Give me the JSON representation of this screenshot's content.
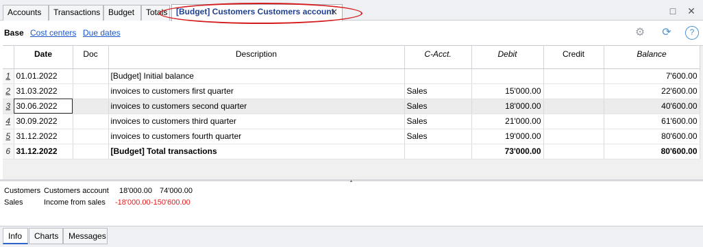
{
  "tabs": [
    {
      "label": "Accounts"
    },
    {
      "label": "Transactions"
    },
    {
      "label": "Budget"
    },
    {
      "label": "Totals"
    },
    {
      "label": "[Budget] Customers Customers account"
    }
  ],
  "window_buttons": {
    "restore": "□",
    "close": "✕"
  },
  "subtabs": {
    "base": "Base",
    "cost_centers": "Cost centers",
    "due_dates": "Due dates"
  },
  "toolbar": {
    "help": "?"
  },
  "columns": [
    "Date",
    "Doc",
    "Description",
    "C-Acct.",
    "Debit",
    "Credit",
    "Balance"
  ],
  "rows": [
    {
      "num": "1",
      "date": "01.01.2022",
      "doc": "",
      "desc": "[Budget] Initial balance",
      "cacct": "",
      "debit": "",
      "credit": "",
      "balance": "7'600.00"
    },
    {
      "num": "2",
      "date": "31.03.2022",
      "doc": "",
      "desc": "invoices to customers first quarter",
      "cacct": "Sales",
      "debit": "15'000.00",
      "credit": "",
      "balance": "22'600.00"
    },
    {
      "num": "3",
      "date": "30.06.2022",
      "doc": "",
      "desc": "invoices to customers second quarter",
      "cacct": "Sales",
      "debit": "18'000.00",
      "credit": "",
      "balance": "40'600.00"
    },
    {
      "num": "4",
      "date": "30.09.2022",
      "doc": "",
      "desc": "invoices to customers third quarter",
      "cacct": "Sales",
      "debit": "21'000.00",
      "credit": "",
      "balance": "61'600.00"
    },
    {
      "num": "5",
      "date": "31.12.2022",
      "doc": "",
      "desc": "invoices to customers fourth quarter",
      "cacct": "Sales",
      "debit": "19'000.00",
      "credit": "",
      "balance": "80'600.00"
    },
    {
      "num": "6",
      "date": "31.12.2022",
      "doc": "",
      "desc": "[Budget] Total transactions",
      "cacct": "",
      "debit": "73'000.00",
      "credit": "",
      "balance": "80'600.00"
    }
  ],
  "info": [
    {
      "account": "Customers",
      "name": "Customers account",
      "v1": "18'000.00",
      "v2": "74'000.00"
    },
    {
      "account": "Sales",
      "name": "Income from sales",
      "v1": "-18'000.00",
      "v2": "-150'600.00"
    }
  ],
  "bottom_tabs": {
    "info": "Info",
    "charts": "Charts",
    "messages": "Messages"
  },
  "colors": {
    "accent": "#1f3f8f",
    "highlight_ellipse": "#d41a1a",
    "negative": "#e01b1b",
    "link": "#1a56c9"
  }
}
